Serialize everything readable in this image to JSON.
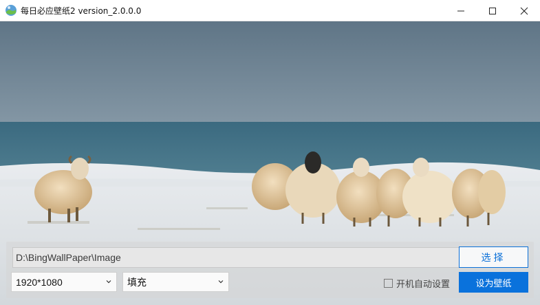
{
  "window": {
    "title": "每日必应壁纸2 version_2.0.0.0",
    "controls": [
      "minimize",
      "maximize",
      "close"
    ]
  },
  "wallpaper": {
    "subject": "sheep on snowy shore"
  },
  "panel": {
    "path_value": "D:\\BingWallPaper\\Image",
    "choose_label": "选择",
    "resolution_value": "1920*1080",
    "fill_mode_value": "填充",
    "autostart_label": "开机自动设置",
    "autostart_checked": false,
    "set_wallpaper_label": "设为壁纸"
  },
  "colors": {
    "accent": "#0a72dc",
    "sky": "#6f8596",
    "sea": "#3f6f85"
  }
}
